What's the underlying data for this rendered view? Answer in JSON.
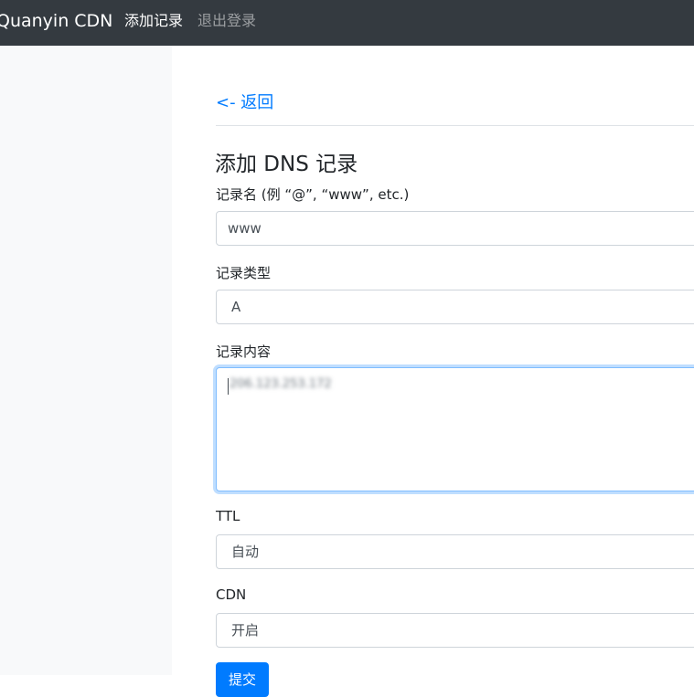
{
  "navbar": {
    "brand": "Quanyin CDN",
    "links": [
      {
        "label": "添加记录"
      },
      {
        "label": "退出登录"
      }
    ]
  },
  "main": {
    "back_link": "<- 返回",
    "title": "添加 DNS 记录",
    "form": {
      "name_label": "记录名 (例 “@”, “www”, etc.)",
      "name_value": "www",
      "type_label": "记录类型",
      "type_value": "A",
      "content_label": "记录内容",
      "content_value": "206.123.253.172",
      "ttl_label": "TTL",
      "ttl_value": "自动",
      "cdn_label": "CDN",
      "cdn_value": "开启",
      "submit_label": "提交"
    }
  },
  "colors": {
    "navbar_bg": "#343a40",
    "sidebar_bg": "#f8f9fa",
    "link": "#007bff",
    "primary_button": "#007bff"
  }
}
